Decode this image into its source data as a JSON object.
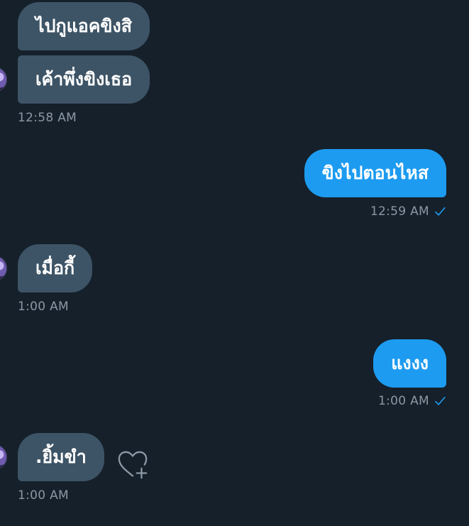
{
  "messages": [
    {
      "text": "ไปกูแอคขิงสิ",
      "direction": "incoming"
    },
    {
      "text": "เค้าพึ่งขิงเธอ",
      "direction": "incoming",
      "time": "12:58 AM"
    },
    {
      "text": "ขิงไปตอนไหส",
      "direction": "outgoing",
      "time": "12:59 AM"
    },
    {
      "text": "เมื่อกี้",
      "direction": "incoming",
      "time": "1:00 AM"
    },
    {
      "text": "แงงง",
      "direction": "outgoing",
      "time": "1:00 AM"
    },
    {
      "text": ".ยิ้มขำ",
      "direction": "incoming",
      "time": "1:00 AM"
    }
  ],
  "colors": {
    "background": "#15202b",
    "incoming_bubble": "#3d5466",
    "outgoing_bubble": "#1d9bf0",
    "timestamp": "#8b98a5"
  },
  "icons": {
    "read_receipt": "checkmark-icon",
    "react": "heart-plus-icon",
    "avatar": "user-avatar"
  }
}
